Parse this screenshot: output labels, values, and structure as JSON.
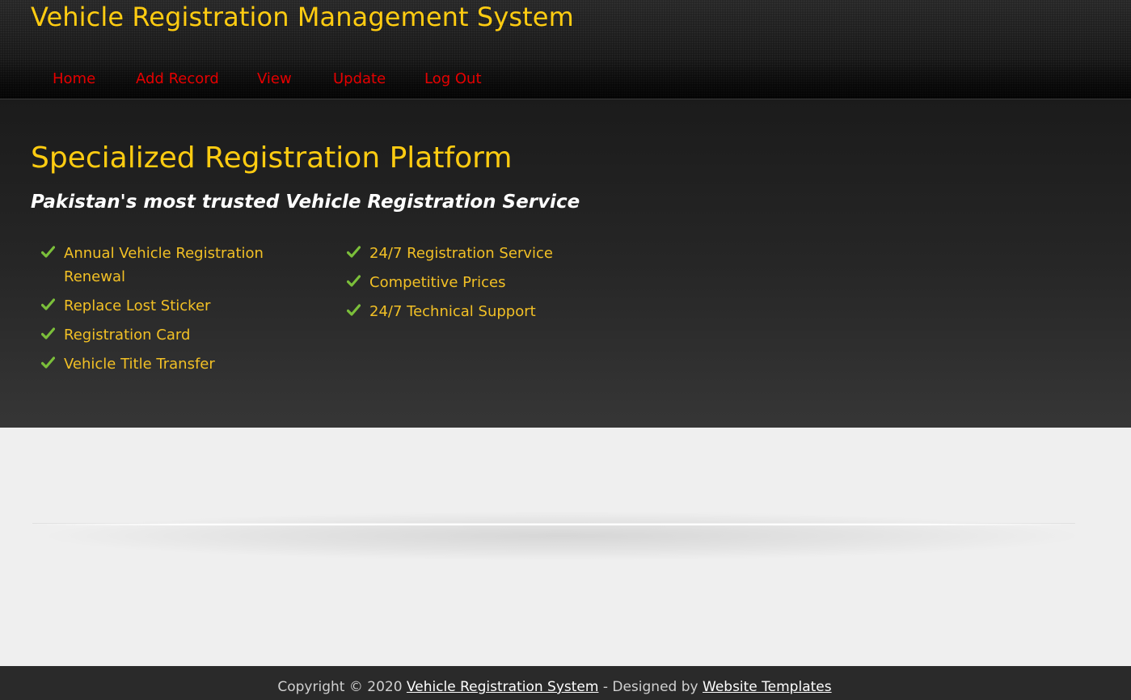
{
  "header": {
    "site_title": "Vehicle Registration Management System"
  },
  "nav": {
    "items": [
      {
        "label": "Home"
      },
      {
        "label": "Add Record"
      },
      {
        "label": "View"
      },
      {
        "label": "Update"
      },
      {
        "label": "Log Out"
      }
    ]
  },
  "hero": {
    "title": "Specialized Registration Platform",
    "subtitle": "Pakistan's most trusted Vehicle Registration Service",
    "features_left": [
      "Annual Vehicle Registration Renewal",
      "Replace Lost Sticker",
      "Registration Card",
      "Vehicle Title Transfer"
    ],
    "features_right": [
      "24/7 Registration Service",
      "Competitive Prices",
      "24/7 Technical Support"
    ]
  },
  "footer": {
    "copyright_prefix": "Copyright © 2020",
    "site_link": "Vehicle Registration System",
    "designed_by": "- Designed by",
    "designer_link": "Website Templates"
  },
  "icons": {
    "feature_bullet": "check-icon"
  },
  "colors": {
    "title": "#ffcc11",
    "nav_link": "#e60000",
    "feature_text": "#f2c025",
    "check": "#7bbf3a"
  }
}
